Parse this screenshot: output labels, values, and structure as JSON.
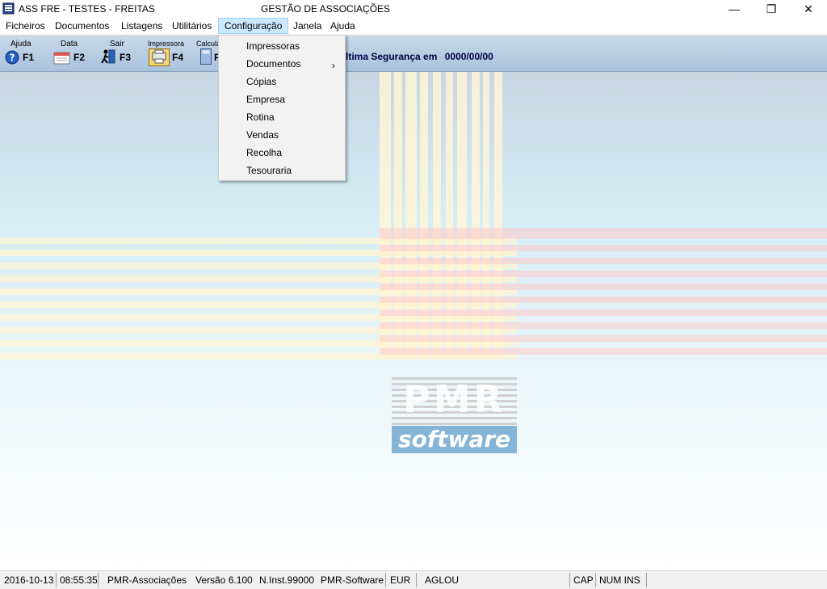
{
  "window": {
    "title": "ASS FRE - TESTES - FREITAS",
    "center_title": "GESTÃO DE ASSOCIAÇÕES",
    "controls": {
      "minimize": "—",
      "restore": "❐",
      "close": "✕"
    }
  },
  "menubar": {
    "items": [
      "Ficheiros",
      "Documentos",
      "Listagens",
      "Utilitários",
      "Configuração",
      "Janela",
      "Ajuda"
    ],
    "active": "Configuração"
  },
  "toolbar": {
    "buttons": [
      {
        "top": "Ajuda",
        "key": "F1",
        "icon": "help-icon"
      },
      {
        "top": "Data",
        "key": "F2",
        "icon": "calendar-icon"
      },
      {
        "top": "Sair",
        "key": "F3",
        "icon": "exit-icon"
      },
      {
        "top": "Impressora",
        "key": "F4",
        "icon": "printer-icon"
      },
      {
        "top": "Calcula",
        "key": "F",
        "icon": "calculator-icon"
      }
    ],
    "status_label": "ltima Segurança em",
    "status_value": "0000/00/00"
  },
  "dropdown": {
    "items": [
      "Impressoras",
      "Documentos",
      "Cópias",
      "Empresa",
      "Rotina",
      "Vendas",
      "Recolha",
      "Tesouraria"
    ],
    "submenu_arrow": "›"
  },
  "logo": {
    "brand": "PMR",
    "sub": "software"
  },
  "statusbar": {
    "date": "2016-10-13",
    "time": "08:55:35",
    "app": "PMR-Associações",
    "version": "Versão  6.100",
    "install": "N.Inst.99000",
    "company": "PMR-Software",
    "currency": "EUR",
    "user": "AGLOU",
    "cap": "CAP",
    "num_ins": "NUM INS"
  },
  "colors": {
    "accent": "#cce8ff",
    "toolbar": "#b9cde2",
    "logo_blue": "#86b4d6"
  }
}
